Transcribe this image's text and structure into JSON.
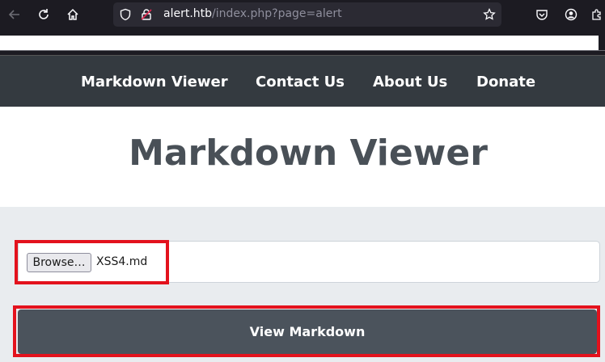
{
  "browser": {
    "url_host": "alert.htb",
    "url_path": "/index.php?page=alert"
  },
  "nav": {
    "items": [
      "Markdown Viewer",
      "Contact Us",
      "About Us",
      "Donate"
    ]
  },
  "page": {
    "title": "Markdown Viewer"
  },
  "form": {
    "browse_label": "Browse…",
    "file_name": "XSS4.md",
    "submit_label": "View Markdown"
  },
  "colors": {
    "nav_bg": "#343a40",
    "button_bg": "#4b535c",
    "highlight": "#e3121d",
    "title": "#495057"
  },
  "icons": [
    "back-icon",
    "reload-icon",
    "home-icon",
    "shield-icon",
    "lock-insecure-icon",
    "star-icon",
    "pocket-icon",
    "account-icon",
    "extensions-icon"
  ]
}
